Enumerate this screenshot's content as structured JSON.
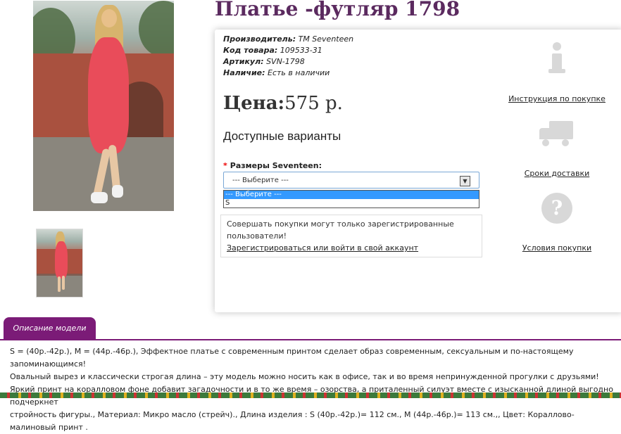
{
  "product": {
    "title": "Платье -футляр 1798",
    "manufacturer_label": "Производитель:",
    "manufacturer_value": "TM Seventeen",
    "code_label": "Код товара:",
    "code_value": "109533-31",
    "article_label": "Артикул:",
    "article_value": "SVN-1798",
    "availability_label": "Наличие:",
    "availability_value": "Есть в наличии",
    "price_label": "Цена:",
    "price_value": "575 р.",
    "variants_title": "Доступные варианты",
    "size_required_mark": "*",
    "size_label": "Размеры Seventeen:",
    "size_select_value": "--- Выберите ---",
    "size_options": [
      "--- Выберите ---",
      "S"
    ]
  },
  "notice": {
    "text": "Совершать покупки могут только зарегистрированные пользователи!",
    "link": "Зарегистрироваться или войти в свой аккаунт"
  },
  "side_links": {
    "instruction": "Инструкция по покупке",
    "delivery": "Сроки доставки",
    "terms": "Условия покупки"
  },
  "icons": {
    "instruction": "info-icon",
    "delivery": "truck-icon",
    "terms": "question-icon"
  },
  "description": {
    "tab_label": "Описание модели",
    "line1": "S = (40р.-42р.), M = (44р.-46р.), Эффектное платье с современным принтом сделает образ современным, сексуальным и по-настоящему запоминающимся!",
    "line2": "Овальный вырез и классически строгая длина – эту модель можно носить как в офисе, так и во время непринужденной прогулки с друзьями!",
    "line3": "Яркий принт на коралловом фоне добавит загадочности и в то же время – озорства, а приталенный силуэт вместе с изысканной длиной выгодно подчеркнет",
    "line4": "стройность фигуры., Материал: Микро масло (стрейч)., Длина изделия : S (40р.-42р.)= 112 см., M (44р.-46р.)= 113 см.,, Цвет: Кораллово-малиновый принт ."
  },
  "colors": {
    "title": "#5b2a5f",
    "tab": "#7b1b77",
    "select_highlight": "#3399ff"
  }
}
